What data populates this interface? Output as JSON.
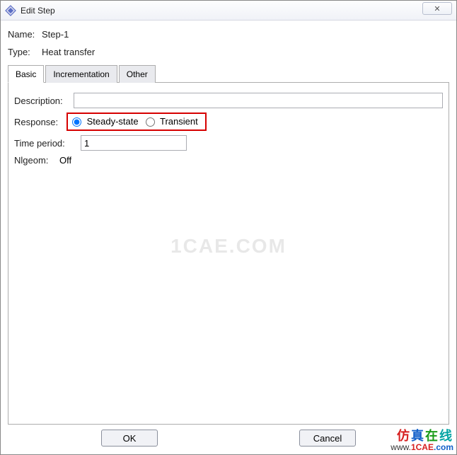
{
  "window": {
    "title": "Edit Step",
    "close_label": "✕"
  },
  "fields": {
    "name_label": "Name:",
    "name_value": "Step-1",
    "type_label": "Type:",
    "type_value": "Heat transfer"
  },
  "tabs": {
    "basic": "Basic",
    "incrementation": "Incrementation",
    "other": "Other",
    "active": "basic"
  },
  "basic": {
    "description_label": "Description:",
    "description_value": "",
    "response_label": "Response:",
    "response_options": {
      "steady": "Steady-state",
      "transient": "Transient"
    },
    "response_selected": "steady",
    "time_period_label": "Time period:",
    "time_period_value": "1",
    "nlgeom_label": "Nlgeom:",
    "nlgeom_value": "Off"
  },
  "buttons": {
    "ok": "OK",
    "cancel": "Cancel"
  },
  "watermark": "1CAE.COM",
  "brand": {
    "cn": "仿真在线",
    "url_prefix": "www.",
    "url_core": "1CAE",
    "url_suffix": ".com"
  }
}
